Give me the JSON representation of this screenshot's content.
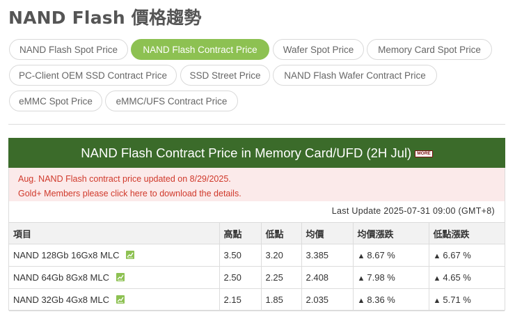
{
  "page_title": "NAND Flash 價格趨勢",
  "tabs": [
    {
      "label": "NAND Flash Spot Price",
      "active": false
    },
    {
      "label": "NAND Flash Contract Price",
      "active": true
    },
    {
      "label": "Wafer Spot Price",
      "active": false
    },
    {
      "label": "Memory Card Spot Price",
      "active": false
    },
    {
      "label": "PC-Client OEM SSD Contract Price",
      "active": false
    },
    {
      "label": "SSD Street Price",
      "active": false
    },
    {
      "label": "NAND Flash Wafer Contract Price",
      "active": false
    },
    {
      "label": "eMMC Spot Price",
      "active": false
    },
    {
      "label": "eMMC/UFS Contract Price",
      "active": false
    }
  ],
  "panel": {
    "title": "NAND Flash Contract Price in Memory Card/UFD (2H Jul)",
    "more_badge": "MORE",
    "notice_line1": "Aug. NAND Flash contract price updated on 8/29/2025.",
    "notice_line2": "Gold+ Members please click here to download the details.",
    "last_update": "Last Update 2025-07-31 09:00 (GMT+8)"
  },
  "table": {
    "headers": [
      "項目",
      "高點",
      "低點",
      "均價",
      "均價漲跌",
      "低點漲跌"
    ],
    "rows": [
      {
        "item": "NAND 128Gb 16Gx8 MLC",
        "high": "3.50",
        "low": "3.20",
        "avg": "3.385",
        "avg_change": "8.67 %",
        "low_change": "6.67 %"
      },
      {
        "item": "NAND 64Gb 8Gx8 MLC",
        "high": "2.50",
        "low": "2.25",
        "avg": "2.408",
        "avg_change": "7.98 %",
        "low_change": "4.65 %"
      },
      {
        "item": "NAND 32Gb 4Gx8 MLC",
        "high": "2.15",
        "low": "1.85",
        "avg": "2.035",
        "avg_change": "8.36 %",
        "low_change": "5.71 %"
      }
    ],
    "up_arrow": "▲"
  },
  "colors": {
    "accent_green": "#8dc152",
    "header_green": "#3b6b2a",
    "alert_red": "#d0392b",
    "notice_bg": "#fbeaea"
  }
}
